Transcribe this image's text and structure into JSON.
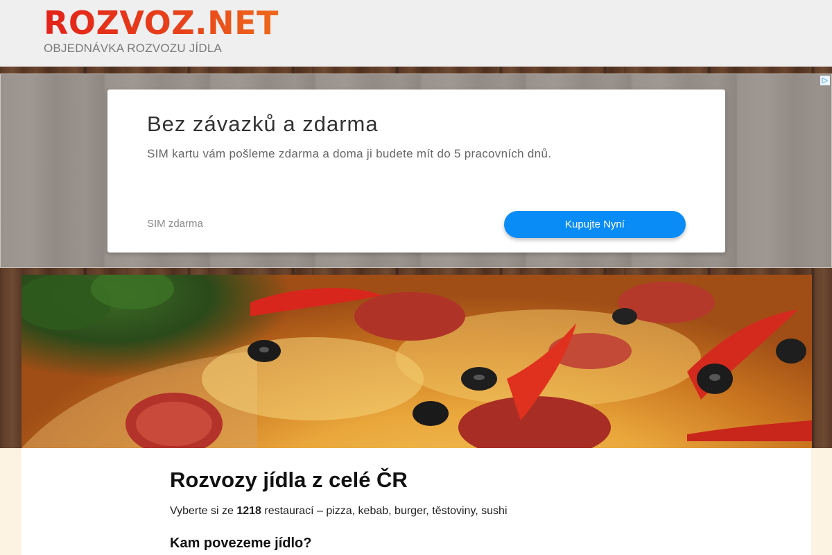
{
  "header": {
    "logo": "ROZVOZ.NET",
    "tagline": "OBJEDNÁVKA ROZVOZU JÍDLA"
  },
  "ad": {
    "choices_icon": "adchoices-icon",
    "title": "Bez závazků a zdarma",
    "description": "SIM kartu vám pošleme zdarma a doma ji budete mít do 5 pracovních dnů.",
    "sponsor": "SIM zdarma",
    "cta": "Kupujte Nyní",
    "cta_color": "#0a8cf6"
  },
  "main": {
    "title": "Rozvozy jídla z celé ČR",
    "intro_prefix": "Vyberte si ze ",
    "restaurant_count": "1218",
    "intro_suffix": " restaurací – pizza, kebab, burger, těstoviny, sushi",
    "subtitle": "Kam povezeme jídlo?"
  },
  "colors": {
    "brand_red": "#e2231a",
    "brand_orange": "#ee6a1c",
    "page_bg": "#fdf3e3"
  }
}
